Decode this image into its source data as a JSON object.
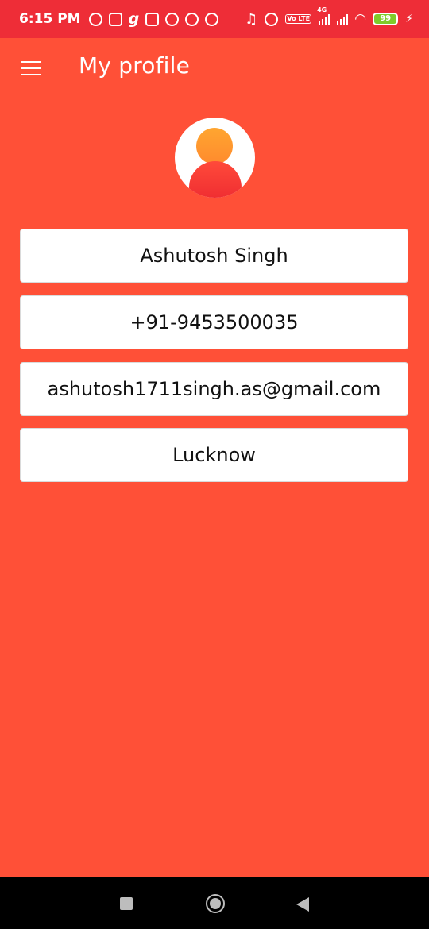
{
  "status_bar": {
    "time": "6:15 PM",
    "left_icons": [
      "move-icon",
      "instagram-icon",
      "g-icon",
      "news-icon",
      "app-icon",
      "whatsapp-icon",
      "app-icon"
    ],
    "right_icons": [
      "headphones-icon",
      "alarm-icon",
      "volte-icon",
      "signal-icon",
      "signal-icon",
      "wifi-icon"
    ],
    "network_label": "4G",
    "volte_label": "Vo LTE",
    "battery": "99"
  },
  "app_bar": {
    "title": "My profile"
  },
  "profile": {
    "name": "Ashutosh Singh",
    "phone": "+91-9453500035",
    "email": "ashutosh1711singh.as@gmail.com",
    "city": "Lucknow"
  },
  "colors": {
    "background": "#FF5037",
    "status_bar": "#EE2D37",
    "card": "#FFFFFF"
  }
}
